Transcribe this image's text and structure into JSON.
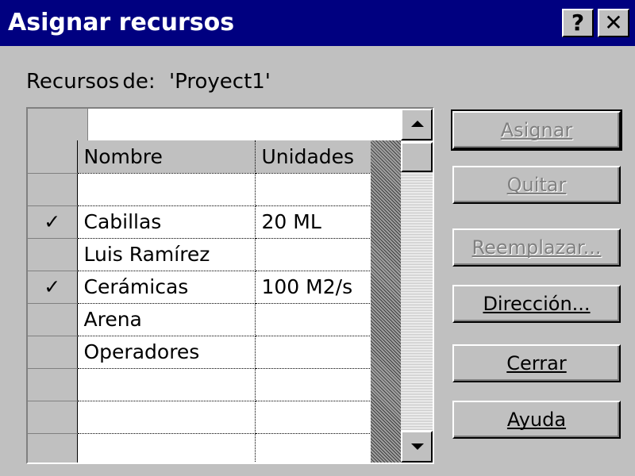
{
  "window": {
    "title": "Asignar recursos",
    "help_button": "?",
    "close_button": "✕"
  },
  "resources_from": {
    "label_part1": "Recursos",
    "label_part2": "de:",
    "project": "'Proyect1'"
  },
  "grid": {
    "edit_value": "",
    "columns": [
      "Nombre",
      "Unidades"
    ],
    "rows": [
      {
        "check": "",
        "name": "",
        "units": ""
      },
      {
        "check": "✓",
        "name": "Cabillas",
        "units": "20 ML"
      },
      {
        "check": "",
        "name": "Luis Ramírez",
        "units": ""
      },
      {
        "check": "✓",
        "name": "Cerámicas",
        "units": "100 M2/s"
      },
      {
        "check": "",
        "name": "Arena",
        "units": ""
      },
      {
        "check": "",
        "name": "Operadores",
        "units": ""
      },
      {
        "check": "",
        "name": "",
        "units": ""
      },
      {
        "check": "",
        "name": "",
        "units": ""
      },
      {
        "check": "",
        "name": "",
        "units": ""
      }
    ]
  },
  "buttons": {
    "assign": "Asignar",
    "remove": "Quitar",
    "replace": "Reemplazar...",
    "address": "Dirección...",
    "close": "Cerrar",
    "help": "Ayuda"
  },
  "colors": {
    "titlebar": "#000080",
    "face": "#c0c0c0"
  }
}
